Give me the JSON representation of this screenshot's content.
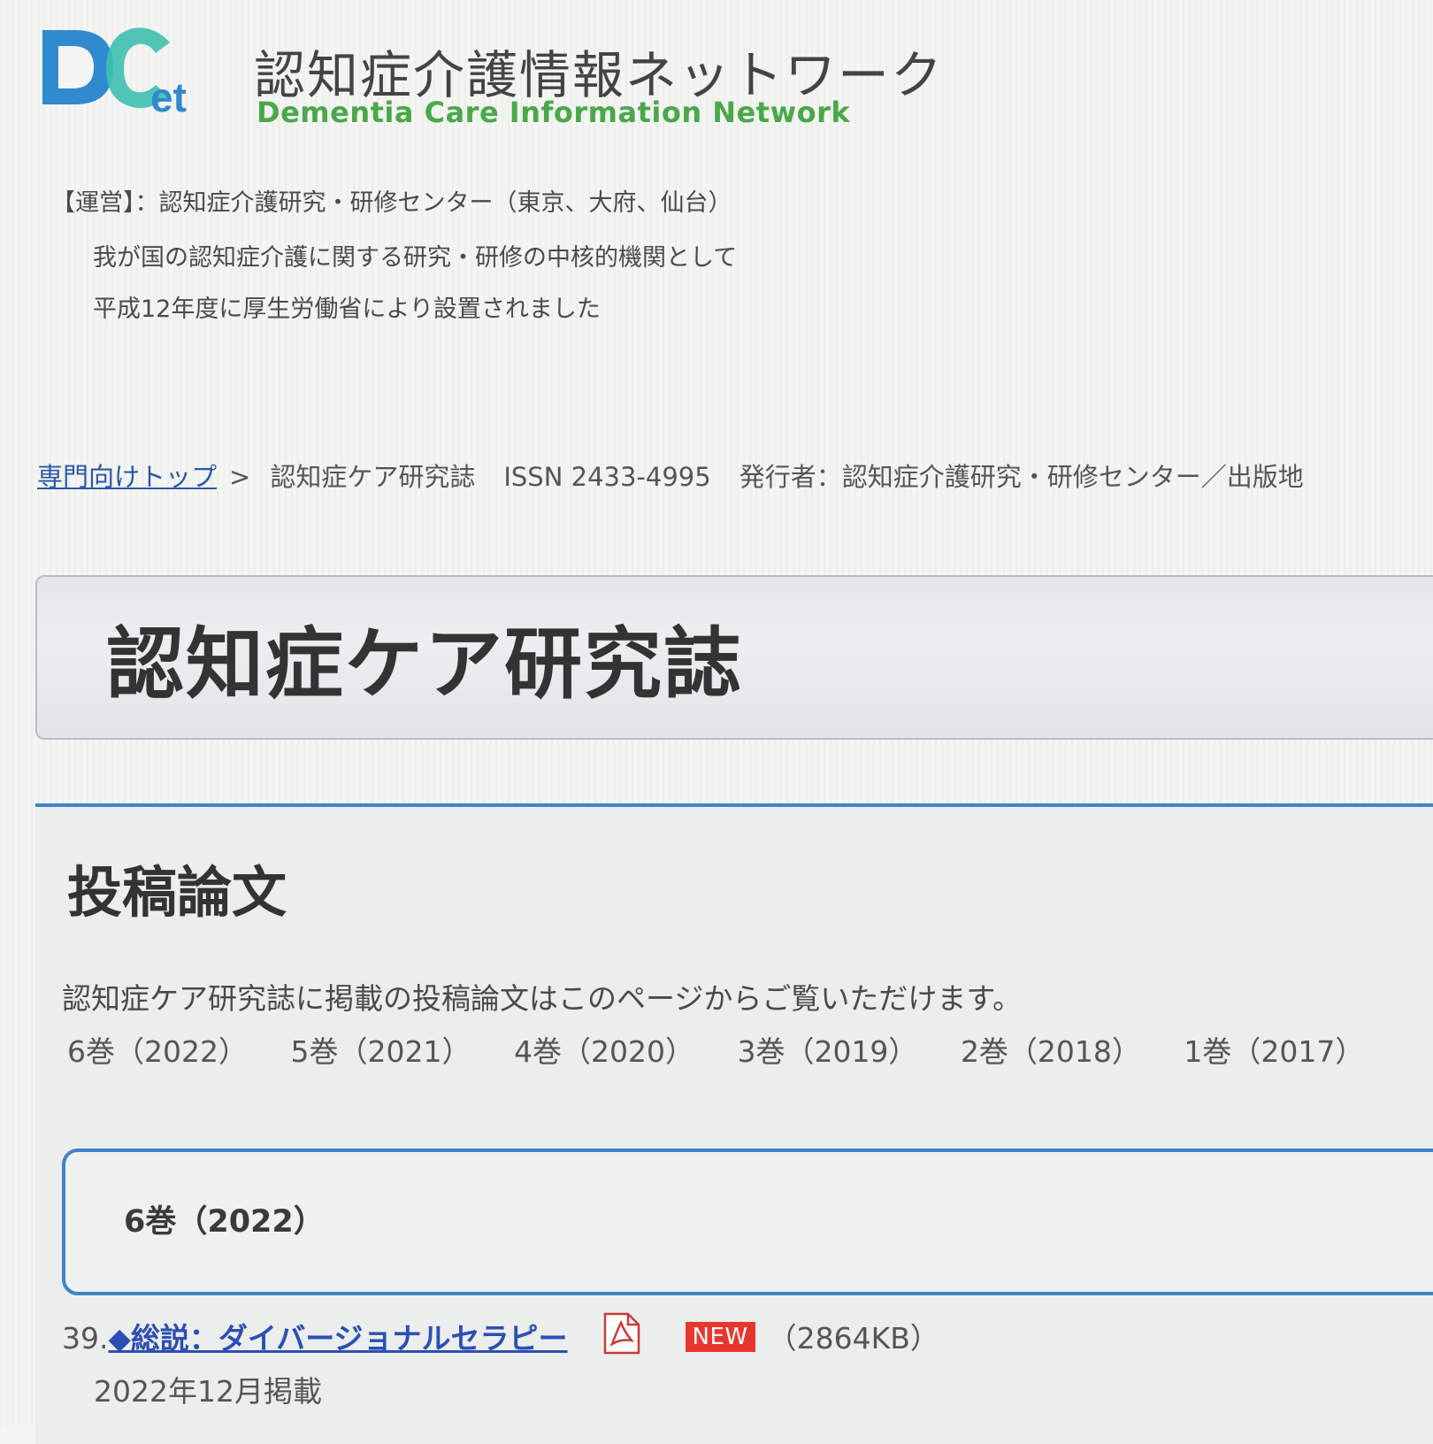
{
  "header": {
    "logo_text": "DCnet",
    "site_title": "認知症介護情報ネットワーク",
    "site_subtitle": "Dementia Care Information Network"
  },
  "operator": {
    "text": "【運営】：認知症介護研究・研修センター（東京、大府、仙台）",
    "intro_line1": "我が国の認知症介護に関する研究・研修の中核的機関として",
    "intro_line2": "平成12年度に厚生労働省により設置されました"
  },
  "breadcrumb": {
    "home": "専門向けトップ",
    "separator": ">",
    "current": "認知症ケア研究誌",
    "issn": "ISSN 2433-4995",
    "publisher": "発行者：認知症介護研究・研修センター／出版地"
  },
  "page_title": "認知症ケア研究誌",
  "section": {
    "title": "投稿論文",
    "description": "認知症ケア研究誌に掲載の投稿論文はこのページからご覧いただけます。",
    "volumes": [
      "6巻（2022）",
      "5巻（2021）",
      "4巻（2020）",
      "3巻（2019）",
      "2巻（2018）",
      "1巻（2017）"
    ]
  },
  "volume_box": {
    "heading": "6巻（2022）"
  },
  "article": {
    "number": "39.",
    "title": "◆総説：ダイバージョナルセラピー",
    "icon": "pdf-icon",
    "badge": "NEW",
    "size": "（2864KB）",
    "date": "2022年12月掲載"
  },
  "colors": {
    "accent_blue": "#3f84c6",
    "link_blue": "#2b4fb4",
    "subtitle_green": "#4aa84a",
    "badge_red": "#e8362e"
  }
}
